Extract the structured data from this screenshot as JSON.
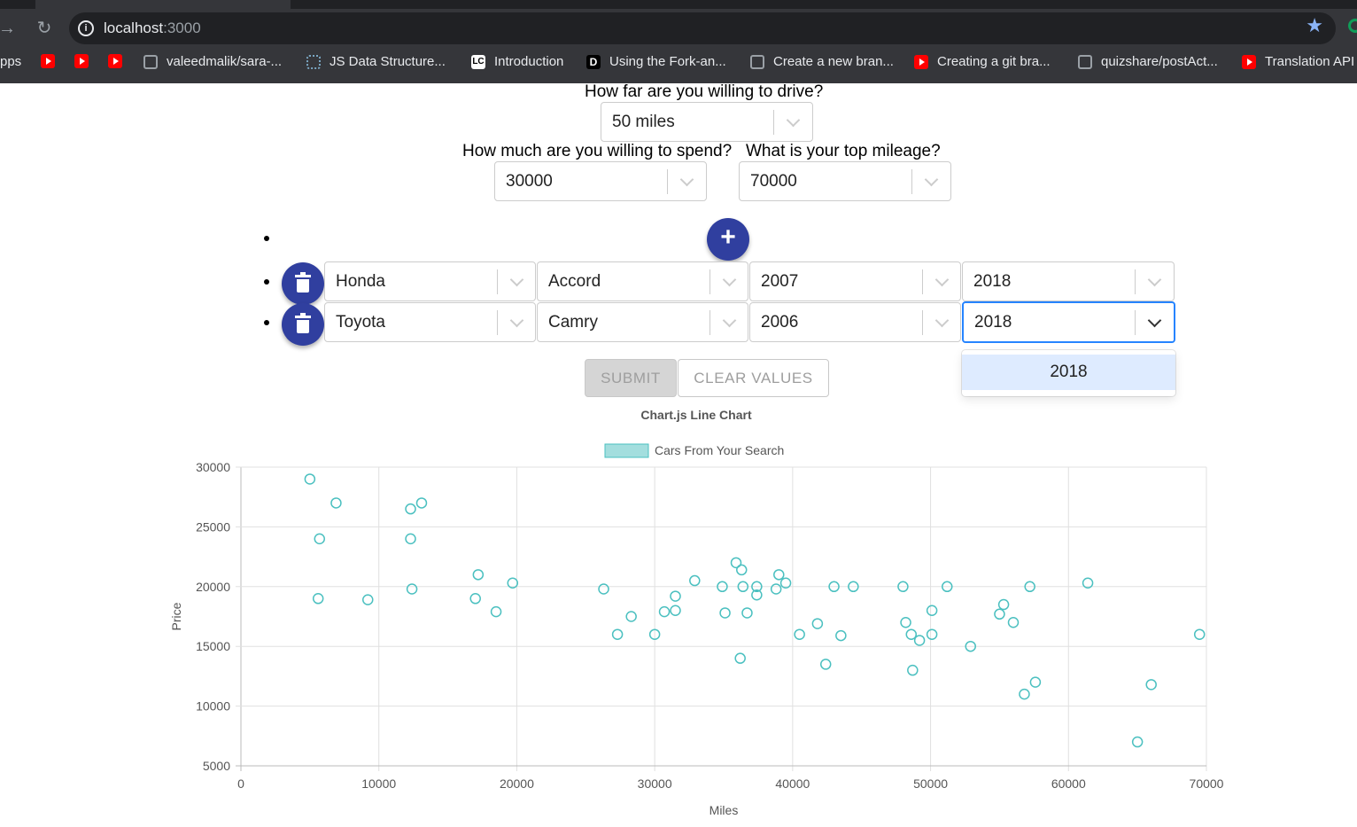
{
  "browser": {
    "url_host": "localhost",
    "url_port": ":3000",
    "bookmarks": [
      {
        "label": "pps",
        "favicon": "none"
      },
      {
        "label": "",
        "favicon": "youtube-icon"
      },
      {
        "label": "",
        "favicon": "youtube-icon"
      },
      {
        "label": "",
        "favicon": "youtube-icon"
      },
      {
        "label": "valeedmalik/sara-...",
        "favicon": "github-icon"
      },
      {
        "label": "JS Data Structure...",
        "favicon": "dotted-circle-icon"
      },
      {
        "label": "Introduction",
        "favicon": "leetcode-icon"
      },
      {
        "label": "Using the Fork-an...",
        "favicon": "d-icon"
      },
      {
        "label": "Create a new bran...",
        "favicon": "github-icon"
      },
      {
        "label": "Creating a git bra...",
        "favicon": "youtube-icon"
      },
      {
        "label": "quizshare/postAct...",
        "favicon": "github-icon"
      },
      {
        "label": "Translation API",
        "favicon": "youtube-icon"
      }
    ]
  },
  "form": {
    "distance_question": "How far are you willing to drive?",
    "distance_value": "50 miles",
    "spend_question": "How much are you willing to spend?",
    "spend_value": "30000",
    "mileage_question": "What is your top mileage?",
    "mileage_value": "70000",
    "add_label": "+",
    "rows": [
      {
        "make": "Honda",
        "model": "Accord",
        "year_from": "2007",
        "year_to": "2018"
      },
      {
        "make": "Toyota",
        "model": "Camry",
        "year_from": "2006",
        "year_to": "2018"
      }
    ],
    "open_menu_option": "2018",
    "submit_label": "SUBMIT",
    "clear_label": "CLEAR VALUES"
  },
  "colors": {
    "accent": "#303f9f",
    "point_stroke": "#4bc0c0",
    "legend_fill": "#a3dede",
    "focus": "#2684ff"
  },
  "chart_data": {
    "type": "scatter",
    "title": "Chart.js Line Chart",
    "legend": "Cars From Your Search",
    "legend_position": "top",
    "xlabel": "Miles",
    "ylabel": "Price",
    "xlim": [
      0,
      70000
    ],
    "ylim": [
      5000,
      30000
    ],
    "xticks": [
      "0",
      "10000",
      "20000",
      "30000",
      "40000",
      "50000",
      "60000",
      "70000"
    ],
    "yticks": [
      "30000",
      "25000",
      "20000",
      "15000",
      "10000",
      "5000"
    ],
    "grid": true,
    "series": [
      {
        "name": "Cars From Your Search",
        "points": [
          [
            5000,
            29000
          ],
          [
            6900,
            27000
          ],
          [
            5700,
            24000
          ],
          [
            5600,
            19000
          ],
          [
            9200,
            18900
          ],
          [
            12300,
            26500
          ],
          [
            13100,
            27000
          ],
          [
            12300,
            24000
          ],
          [
            12400,
            19800
          ],
          [
            17200,
            21000
          ],
          [
            17000,
            19000
          ],
          [
            18500,
            17900
          ],
          [
            19700,
            20300
          ],
          [
            26300,
            19800
          ],
          [
            27300,
            16000
          ],
          [
            28300,
            17500
          ],
          [
            30000,
            16000
          ],
          [
            30700,
            17900
          ],
          [
            31500,
            18000
          ],
          [
            31500,
            19200
          ],
          [
            32900,
            20500
          ],
          [
            34900,
            20000
          ],
          [
            35100,
            17800
          ],
          [
            35900,
            22000
          ],
          [
            36200,
            14000
          ],
          [
            36300,
            21400
          ],
          [
            36400,
            20000
          ],
          [
            36700,
            17800
          ],
          [
            37400,
            20000
          ],
          [
            37400,
            19300
          ],
          [
            38800,
            19800
          ],
          [
            39000,
            21000
          ],
          [
            39500,
            20300
          ],
          [
            40500,
            16000
          ],
          [
            41800,
            16900
          ],
          [
            42400,
            13500
          ],
          [
            43000,
            20000
          ],
          [
            43500,
            15900
          ],
          [
            44400,
            20000
          ],
          [
            48000,
            20000
          ],
          [
            48200,
            17000
          ],
          [
            48600,
            16000
          ],
          [
            48700,
            13000
          ],
          [
            49200,
            15500
          ],
          [
            50100,
            16000
          ],
          [
            50100,
            18000
          ],
          [
            51200,
            20000
          ],
          [
            52900,
            15000
          ],
          [
            55000,
            17700
          ],
          [
            55300,
            18500
          ],
          [
            56000,
            17000
          ],
          [
            56800,
            11000
          ],
          [
            57200,
            20000
          ],
          [
            57600,
            12000
          ],
          [
            61400,
            20300
          ],
          [
            65000,
            7000
          ],
          [
            66000,
            11800
          ],
          [
            69500,
            16000
          ]
        ]
      }
    ]
  }
}
